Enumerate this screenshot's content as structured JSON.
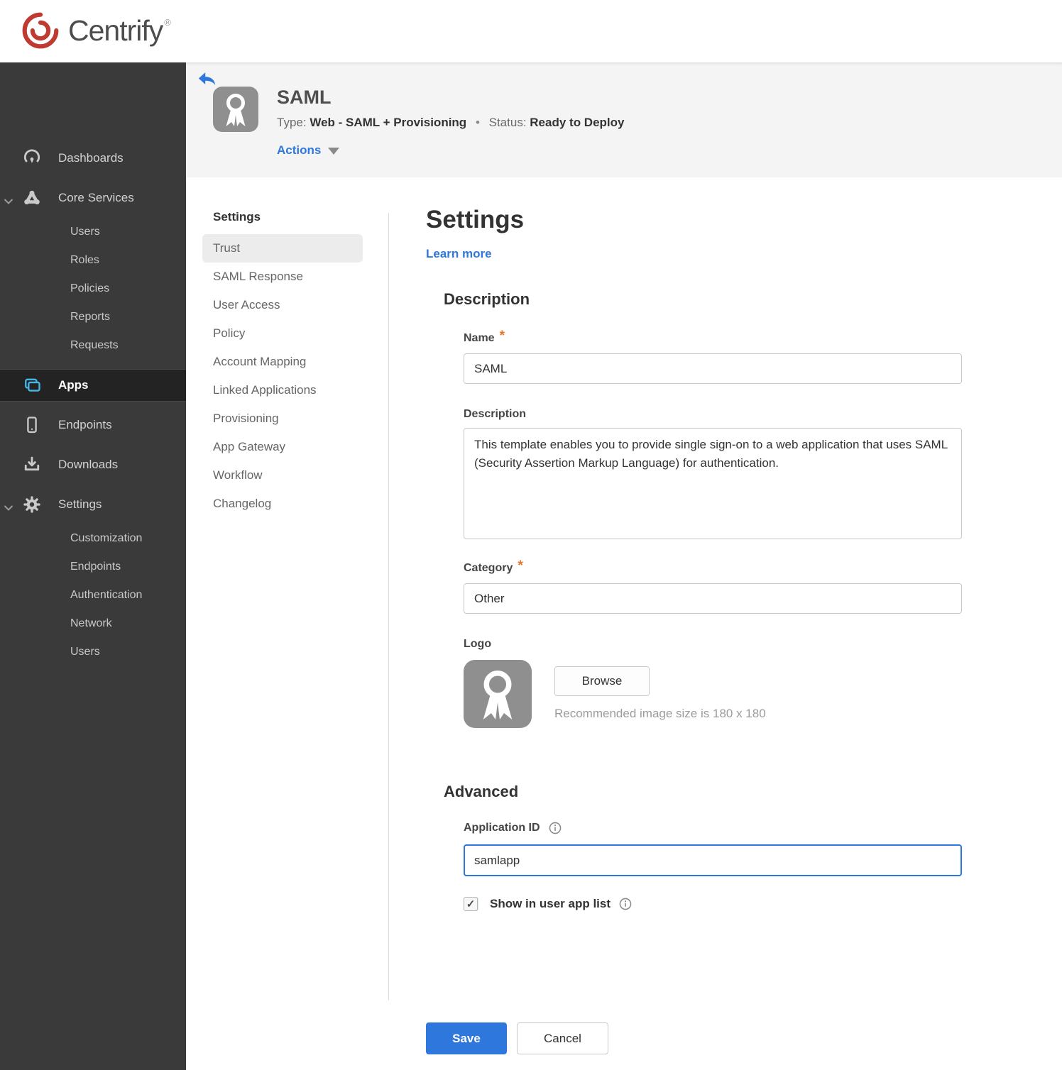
{
  "brand": {
    "name": "Centrify",
    "registered": "®"
  },
  "sidebar": {
    "dashboards": "Dashboards",
    "core_services": "Core Services",
    "core_children": [
      "Users",
      "Roles",
      "Policies",
      "Reports",
      "Requests"
    ],
    "apps": "Apps",
    "endpoints": "Endpoints",
    "downloads": "Downloads",
    "settings": "Settings",
    "settings_children": [
      "Customization",
      "Endpoints",
      "Authentication",
      "Network",
      "Users"
    ]
  },
  "header": {
    "app_name": "SAML",
    "type_label": "Type:",
    "type_value": "Web - SAML + Provisioning",
    "dot": "•",
    "status_label": "Status:",
    "status_value": "Ready to Deploy",
    "actions": "Actions"
  },
  "subnav": {
    "heading": "Settings",
    "items": [
      "Trust",
      "SAML Response",
      "User Access",
      "Policy",
      "Account Mapping",
      "Linked Applications",
      "Provisioning",
      "App Gateway",
      "Workflow",
      "Changelog"
    ],
    "active_item": "Trust"
  },
  "main": {
    "title": "Settings",
    "learn_more": "Learn more",
    "required_marker": "*",
    "description": {
      "heading": "Description",
      "name_label": "Name",
      "name_value": "SAML",
      "description_label": "Description",
      "description_value": "This template enables you to provide single sign-on to a web application that uses SAML (Security Assertion Markup Language) for authentication.",
      "category_label": "Category",
      "category_value": "Other",
      "logo_label": "Logo",
      "browse_button": "Browse",
      "logo_hint": "Recommended image size is 180 x 180"
    },
    "advanced": {
      "heading": "Advanced",
      "application_id_label": "Application ID",
      "application_id_value": "samlapp",
      "show_in_user_app_list_label": "Show in user app list",
      "checkbox_checked": true
    },
    "save_button": "Save",
    "cancel_button": "Cancel"
  },
  "colors": {
    "accent_blue": "#2e77dd",
    "status_red": "#a12a26",
    "brand_red": "#bf3a31",
    "apps_icon_blue": "#45b6ea",
    "required_orange": "#e87724",
    "sidebar_bg": "#3a3a3a",
    "header_band_bg": "#f4f4f4"
  }
}
